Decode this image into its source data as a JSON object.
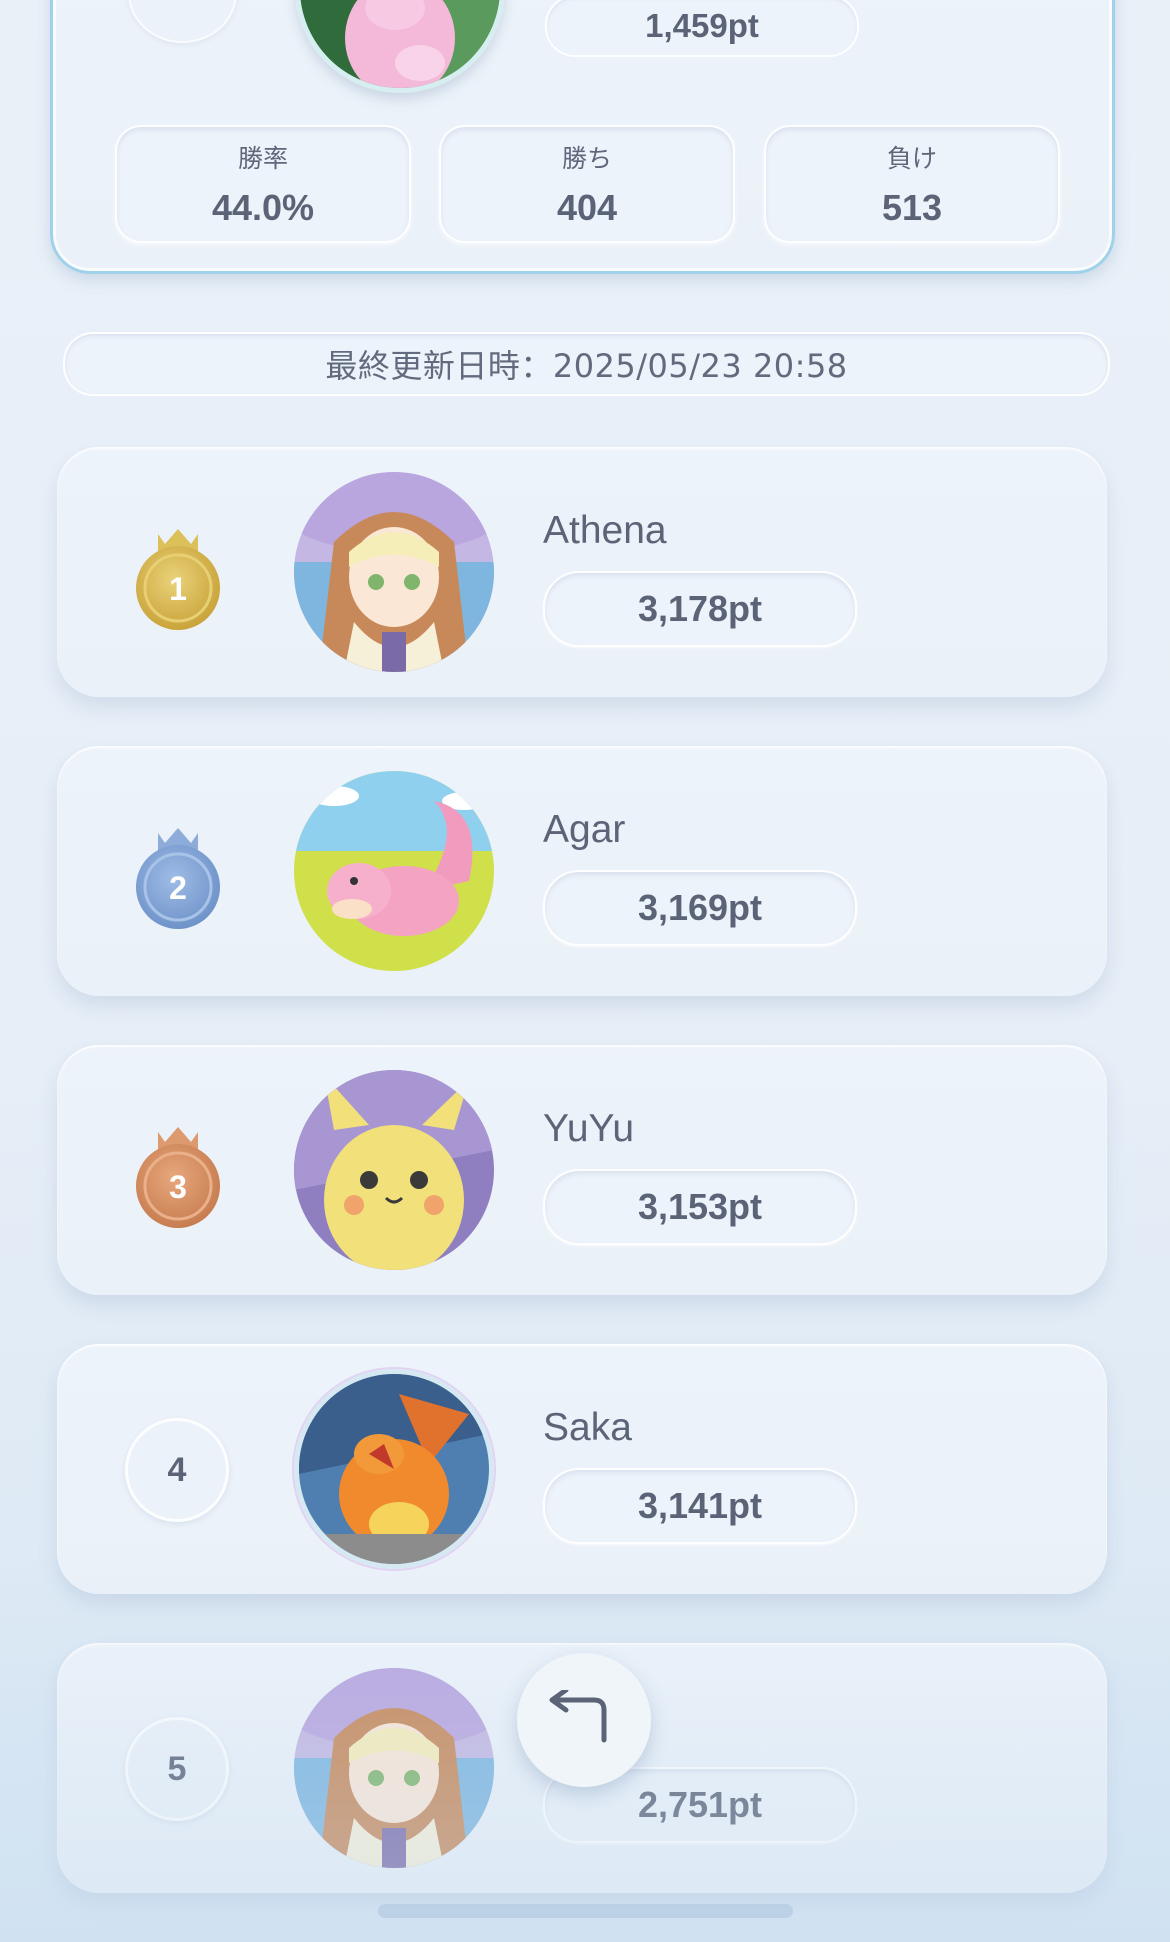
{
  "current_user": {
    "score": "1,459pt",
    "stats": [
      {
        "label": "勝率",
        "value": "44.0%"
      },
      {
        "label": "勝ち",
        "value": "404"
      },
      {
        "label": "負け",
        "value": "513"
      }
    ]
  },
  "last_updated": "最終更新日時：2025/05/23 20:58",
  "ranking": [
    {
      "rank": "1",
      "name": "Athena",
      "score": "3,178pt",
      "medal": "gold",
      "avatar": "girl-blonde-hat-avatar"
    },
    {
      "rank": "2",
      "name": "Agar",
      "score": "3,169pt",
      "medal": "silver-blue",
      "avatar": "pink-slowpoke-avatar"
    },
    {
      "rank": "3",
      "name": "YuYu",
      "score": "3,153pt",
      "medal": "bronze",
      "avatar": "yellow-pikachu-avatar"
    },
    {
      "rank": "4",
      "name": "Saka",
      "score": "3,141pt",
      "medal": "none",
      "avatar": "orange-dragon-avatar"
    },
    {
      "rank": "5",
      "name": "",
      "score": "2,751pt",
      "medal": "none",
      "avatar": "girl-blonde-hat-avatar"
    }
  ],
  "colors": {
    "gold": "#d9b84b",
    "silver_blue": "#7ea2d6",
    "bronze": "#d4895c",
    "text": "#5b6477",
    "card_border": "#9fd2ea"
  },
  "icons": {
    "back": "return-arrow-icon"
  }
}
